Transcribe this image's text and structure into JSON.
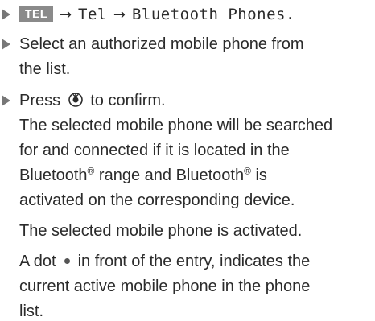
{
  "step1": {
    "key_label": "TEL",
    "arrow": "→",
    "menu_tel": "Tel",
    "menu_phones": "Bluetooth Phones."
  },
  "step2": {
    "line1": "Select an authorized mobile phone from",
    "line2": "the list."
  },
  "step3": {
    "press": "Press",
    "confirm": "to confirm.",
    "result_lines": [
      "The selected mobile phone will be searched",
      "for and connected if it is located in the"
    ],
    "bt_word": "Bluetooth",
    "registered": "®",
    "range_text": " range and ",
    "is_text": " is",
    "activated_line": "activated on the corresponding device.",
    "activated_msg": "The selected mobile phone is activated.",
    "dot_prefix": "A dot",
    "dot_suffix": "in front of the entry, indicates the",
    "dot_lines": [
      "current active mobile phone in the phone",
      "list."
    ]
  }
}
